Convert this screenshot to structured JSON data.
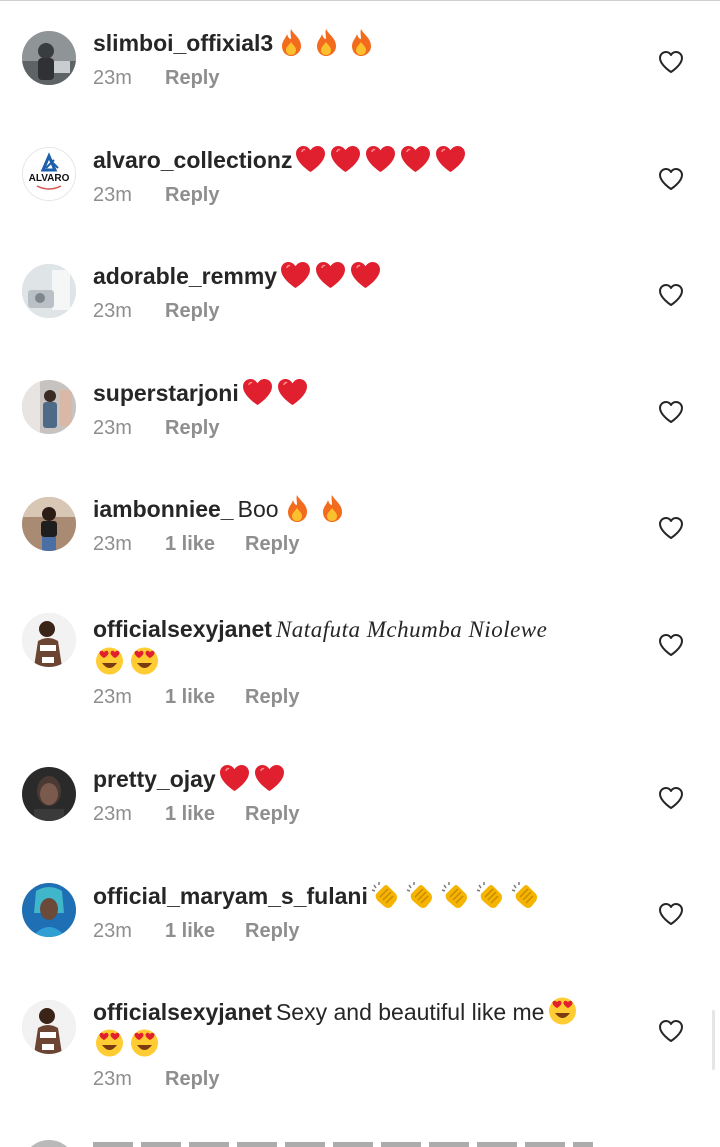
{
  "comments": [
    {
      "username": "slimboi_offixial3",
      "text": "",
      "emojis": [
        "fire",
        "fire",
        "fire"
      ],
      "time": "23m",
      "likes": "",
      "reply_label": "Reply",
      "avatar": "avatar-slimboi"
    },
    {
      "username": "alvaro_collectionz",
      "text": "",
      "emojis": [
        "red-heart",
        "red-heart",
        "red-heart",
        "red-heart",
        "red-heart"
      ],
      "time": "23m",
      "likes": "",
      "reply_label": "Reply",
      "avatar": "avatar-alvaro",
      "avatar_text": "ALVARO"
    },
    {
      "username": "adorable_remmy",
      "text": "",
      "emojis": [
        "red-heart",
        "red-heart",
        "red-heart"
      ],
      "time": "23m",
      "likes": "",
      "reply_label": "Reply",
      "avatar": "avatar-remmy"
    },
    {
      "username": "superstarjoni",
      "text": "",
      "emojis": [
        "red-heart",
        "red-heart"
      ],
      "time": "23m",
      "likes": "",
      "reply_label": "Reply",
      "avatar": "avatar-joni"
    },
    {
      "username": "iambonniee_",
      "text": "Boo",
      "emojis": [
        "fire",
        "fire"
      ],
      "time": "23m",
      "likes": "1 like",
      "reply_label": "Reply",
      "avatar": "avatar-bonniee"
    },
    {
      "username": "officialsexyjanet",
      "text": "Natafuta Mchumba Niolewe",
      "emojis": [
        "heart-eyes",
        "heart-eyes"
      ],
      "time": "23m",
      "likes": "1 like",
      "reply_label": "Reply",
      "avatar": "avatar-janet"
    },
    {
      "username": "pretty_ojay",
      "text": "",
      "emojis": [
        "red-heart",
        "red-heart"
      ],
      "time": "23m",
      "likes": "1 like",
      "reply_label": "Reply",
      "avatar": "avatar-ojay"
    },
    {
      "username": "official_maryam_s_fulani",
      "text": "",
      "emojis": [
        "clapping-hands",
        "clapping-hands",
        "clapping-hands",
        "clapping-hands",
        "clapping-hands"
      ],
      "time": "23m",
      "likes": "1 like",
      "reply_label": "Reply",
      "avatar": "avatar-maryam"
    },
    {
      "username": "officialsexyjanet",
      "text": "Sexy and beautiful like me",
      "emojis": [
        "heart-eyes",
        "heart-eyes",
        "heart-eyes"
      ],
      "time": "23m",
      "likes": "",
      "reply_label": "Reply",
      "avatar": "avatar-janet"
    }
  ],
  "colors": {
    "text": "#262626",
    "meta": "#8e8e8e",
    "heart_outline": "#262626",
    "red_heart": "#e0202e",
    "fire": "#f36b1c",
    "emoji_yellow": "#ffcc33"
  },
  "icons": {
    "like": "heart-outline-icon"
  }
}
